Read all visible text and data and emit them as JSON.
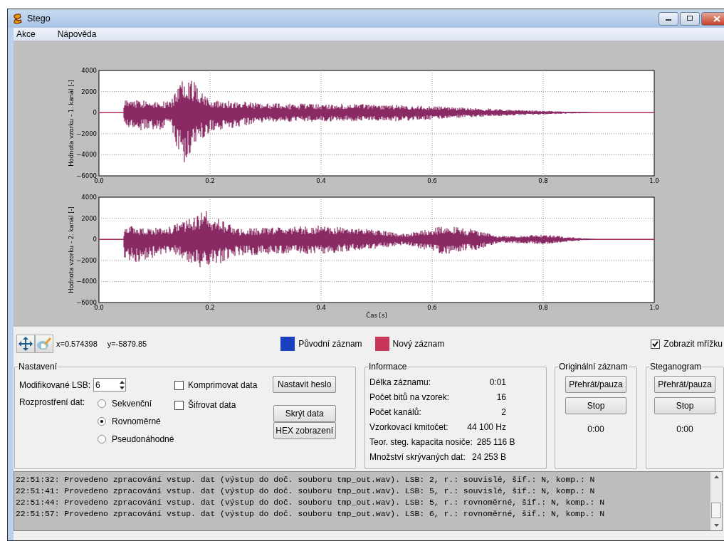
{
  "window": {
    "title": "Stego"
  },
  "menu": [
    "Akce",
    "Nápověda"
  ],
  "plots": [
    {
      "ylabel": "Hodnota vzorku - 1. kanál [-]",
      "yticks": [
        "4000",
        "2000",
        "0",
        "−2000",
        "−4000",
        "−6000"
      ],
      "xticks": [
        "0.0",
        "0.2",
        "0.4",
        "0.6",
        "0.8",
        "1.0"
      ]
    },
    {
      "ylabel": "Hodnota vzorku - 2. kanál [-]",
      "yticks": [
        "4000",
        "2000",
        "0",
        "−2000",
        "−4000",
        "−6000"
      ],
      "xticks": [
        "0.0",
        "0.2",
        "0.4",
        "0.6",
        "0.8",
        "1.0"
      ],
      "xlabel": "Čas [s]"
    }
  ],
  "coordinates": {
    "x": "x=0.574398",
    "y": "y=-5879.85"
  },
  "legend": [
    {
      "label": "Původní záznam",
      "color": "#1a3fbf"
    },
    {
      "label": "Nový záznam",
      "color": "#c8375a"
    }
  ],
  "show_grid": {
    "label": "Zobrazit mřížku",
    "checked": true
  },
  "settings": {
    "title": "Nastavení",
    "lsb_label": "Modifikované LSB:",
    "lsb_value": "6",
    "spread_label": "Rozprostření dat:",
    "spread_options": [
      {
        "label": "Sekvenční",
        "selected": false
      },
      {
        "label": "Rovnoměrné",
        "selected": true
      },
      {
        "label": "Pseudonáhodné",
        "selected": false
      }
    ],
    "options": [
      {
        "label": "Komprimovat data",
        "checked": false
      },
      {
        "label": "Šifrovat data",
        "checked": false
      }
    ],
    "buttons": [
      "Nastavit heslo",
      "Skrýt data",
      "HEX zobrazení"
    ]
  },
  "info": {
    "title": "Informace",
    "rows": [
      {
        "label": "Délka záznamu:",
        "value": "0:01"
      },
      {
        "label": "Počet bitů na vzorek:",
        "value": "16"
      },
      {
        "label": "Počet kanálů:",
        "value": "2"
      },
      {
        "label": "Vzorkovací kmitočet:",
        "value": "44 100 Hz"
      },
      {
        "label": "Teor. steg. kapacita nosiče:",
        "value": "285 116 B"
      },
      {
        "label": "Množství skrývaných dat:",
        "value": "24 253 B"
      }
    ]
  },
  "players": [
    {
      "title": "Originální záznam",
      "buttons": [
        "Přehrát/pauza",
        "Stop"
      ],
      "time": "0:00"
    },
    {
      "title": "Steganogram",
      "buttons": [
        "Přehrát/pauza",
        "Stop"
      ],
      "time": "0:00"
    }
  ],
  "log": [
    "22:51:32: Provedeno zpracování vstup. dat (výstup do doč. souboru tmp_out.wav). LSB: 2, r.: souvislé, šif.: N, komp.: N",
    "22:51:41: Provedeno zpracování vstup. dat (výstup do doč. souboru tmp_out.wav). LSB: 5, r.: souvislé, šif.: N, komp.: N",
    "22:51:44: Provedeno zpracování vstup. dat (výstup do doč. souboru tmp_out.wav). LSB: 5, r.: rovnoměrné, šif.: N, komp.: N",
    "22:51:57: Provedeno zpracování vstup. dat (výstup do doč. souboru tmp_out.wav). LSB: 6, r.: rovnoměrné, šif.: N, komp.: N"
  ]
}
